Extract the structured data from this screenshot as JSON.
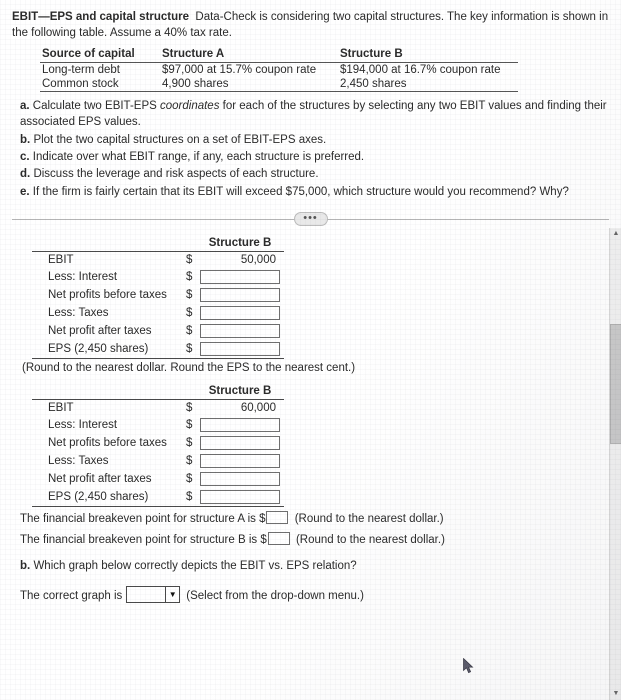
{
  "problem": {
    "title": "EBIT—EPS and capital structure",
    "intro": "Data-Check is considering two capital structures. The key information is shown in the following table. Assume a 40% tax rate."
  },
  "cap_table": {
    "headers": [
      "Source of capital",
      "Structure A",
      "Structure B"
    ],
    "rows": [
      [
        "Long-term debt",
        "$97,000 at 15.7% coupon rate",
        "$194,000 at 16.7% coupon rate"
      ],
      [
        "Common stock",
        "4,900 shares",
        "2,450 shares"
      ]
    ]
  },
  "parts": [
    {
      "label": "a.",
      "text_before": "Calculate two EBIT-EPS ",
      "italic": "coordinates",
      "text_after": " for each of the structures by selecting any two EBIT values and finding their associated EPS values."
    },
    {
      "label": "b.",
      "text_before": "Plot the two capital structures on a set of EBIT-EPS axes.",
      "italic": "",
      "text_after": ""
    },
    {
      "label": "c.",
      "text_before": "Indicate over what EBIT range, if any, each structure is preferred.",
      "italic": "",
      "text_after": ""
    },
    {
      "label": "d.",
      "text_before": "Discuss the leverage and risk aspects of each structure.",
      "italic": "",
      "text_after": ""
    },
    {
      "label": "e.",
      "text_before": "If the firm is fairly certain that its EBIT will exceed $75,000, which structure would you recommend? Why?",
      "italic": "",
      "text_after": ""
    }
  ],
  "divider_icon": "•••",
  "worksheet1": {
    "column_header": "Structure B",
    "rows": [
      {
        "label": "EBIT",
        "dollar": "$",
        "value": "50,000",
        "filled": true
      },
      {
        "label": "Less: Interest",
        "dollar": "$",
        "value": "",
        "filled": false
      },
      {
        "label": "Net profits before taxes",
        "dollar": "$",
        "value": "",
        "filled": false
      },
      {
        "label": "Less: Taxes",
        "dollar": "$",
        "value": "",
        "filled": false
      },
      {
        "label": "Net profit after taxes",
        "dollar": "$",
        "value": "",
        "filled": false
      },
      {
        "label": "EPS (2,450 shares)",
        "dollar": "$",
        "value": "",
        "filled": false
      }
    ],
    "note": "(Round to the nearest dollar. Round the EPS to the nearest cent.)"
  },
  "worksheet2": {
    "column_header": "Structure B",
    "rows": [
      {
        "label": "EBIT",
        "dollar": "$",
        "value": "60,000",
        "filled": true
      },
      {
        "label": "Less: Interest",
        "dollar": "$",
        "value": "",
        "filled": false
      },
      {
        "label": "Net profits before taxes",
        "dollar": "$",
        "value": "",
        "filled": false
      },
      {
        "label": "Less: Taxes",
        "dollar": "$",
        "value": "",
        "filled": false
      },
      {
        "label": "Net profit after taxes",
        "dollar": "$",
        "value": "",
        "filled": false
      },
      {
        "label": "EPS (2,450 shares)",
        "dollar": "$",
        "value": "",
        "filled": false
      }
    ]
  },
  "breakeven": [
    {
      "text_before": "The financial breakeven point for structure A is $",
      "text_after": "(Round to the nearest dollar.)"
    },
    {
      "text_before": "The financial breakeven point for structure B is $",
      "text_after": "(Round to the nearest dollar.)"
    }
  ],
  "question_b": {
    "label": "b.",
    "text": "Which graph below correctly depicts the EBIT vs. EPS relation?"
  },
  "dropdown_row": {
    "prompt": "The correct graph is",
    "value": "",
    "arrow": "▼",
    "hint": "(Select from the drop-down menu.)"
  },
  "scrollbar": {
    "up_arrow": "▲",
    "down_arrow": "▼"
  }
}
